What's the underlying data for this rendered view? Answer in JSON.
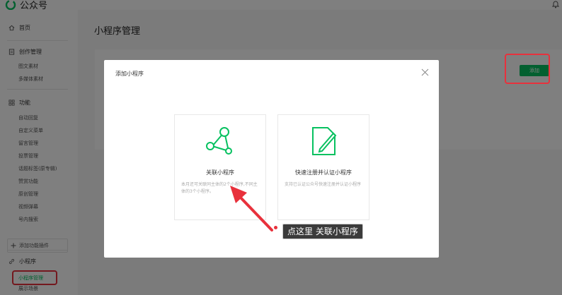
{
  "app": {
    "title": "公众号"
  },
  "colors": {
    "accent": "#07c160",
    "highlight": "#e8313c"
  },
  "sidebar": {
    "home": "首页",
    "create": {
      "label": "创作管理",
      "items": [
        "图文素材",
        "多媒体素材"
      ]
    },
    "features": {
      "label": "功能",
      "items": [
        "自动回复",
        "自定义菜单",
        "留言管理",
        "投票管理",
        "话题标签(原专辑)",
        "赞赏功能",
        "原创管理",
        "视频弹幕",
        "号内搜索"
      ]
    },
    "add_plugin": "添加功能插件",
    "miniprogram": {
      "label": "小程序",
      "items": [
        "小程序管理",
        "展示场景"
      ]
    }
  },
  "main": {
    "title": "小程序管理",
    "add_button": "添加"
  },
  "modal": {
    "title": "添加小程序",
    "options": [
      {
        "title": "关联小程序",
        "desc": "本月还可关联同主体的2个小程序,不同主体的3个小程序。",
        "icon": "share-nodes-icon"
      },
      {
        "title": "快速注册并认证小程序",
        "desc": "支持已认证公众号快速注册并认证小程序",
        "icon": "document-pen-icon"
      }
    ]
  },
  "annotation": {
    "callout": "点这里 关联小程序"
  }
}
